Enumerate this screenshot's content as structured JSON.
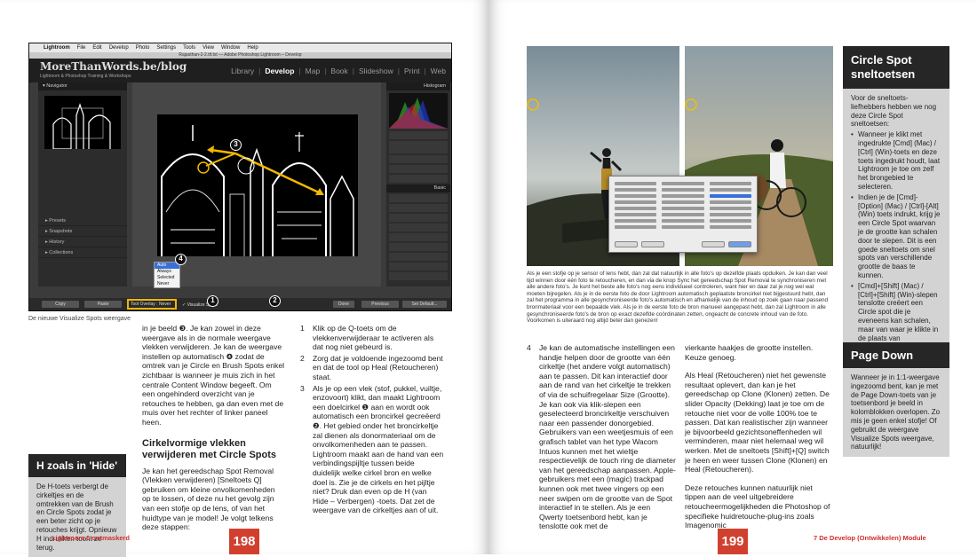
{
  "left_page": {
    "screenshot": {
      "menu_bar": [
        "Lightroom",
        "File",
        "Edit",
        "Develop",
        "Photo",
        "Settings",
        "Tools",
        "View",
        "Window",
        "Help"
      ],
      "window_title": "Rajasthan-2-2.tif.txt — Adobe Photoshop Lightroom – Develop",
      "brand": "MoreThanWords.be/blog",
      "brand_sub": "Lightroom & Photoshop Training & Workshops",
      "modules": [
        "Library",
        "Develop",
        "Map",
        "Book",
        "Slideshow",
        "Print",
        "Web"
      ],
      "active_module": "Develop",
      "left_panels": {
        "navigator": "Navigator",
        "items": [
          "Presets",
          "Snapshots",
          "History",
          "Collections"
        ]
      },
      "right_panels": {
        "histogram": "Histogram",
        "basic": "Basic"
      },
      "bottom_buttons": {
        "copy": "Copy",
        "paste": "Paste",
        "done": "Done",
        "previous": "Previous",
        "set_default": "Set Default..."
      },
      "tool_overlay": "Tool Overlay : Never",
      "visualize_spots": "✓ Visualize Spots",
      "popup_options": [
        "Auto",
        "Always",
        "Selected",
        "Never"
      ],
      "popup_selected": "Auto",
      "badges": [
        "1",
        "2",
        "3",
        "4"
      ]
    },
    "caption": "De nieuwe Visualize Spots weergave",
    "col1_intro": "in je beeld ❸. Je kan zowel in deze weergave als in de normale weergave vlekken verwijderen. Je kan de weergave instellen op automatisch ❹ zodat de omtrek van je Circle en Brush Spots enkel zichtbaar is wanneer je muis zich in het centrale Content Window begeeft. Om een ongehinderd overzicht van je retouches te hebben, ga dan even met de muis over het rechter of linker paneel heen.",
    "col1_heading": "Cirkelvormige vlekken verwijderen met Circle Spots",
    "col1_body": "Je kan het gereedschap Spot Removal (Vlekken verwijderen) [Sneltoets Q] gebruiken om kleine onvolkomenheden op te lossen, of deze nu het gevolg zijn van een stofje op de lens, of van het huidtype van je model! Je volgt telkens deze stappen:",
    "steps": [
      {
        "num": "1",
        "text": "Klik op de Q-toets om de vlekkenverwijderaar te activeren als dat nog niet gebeurd is."
      },
      {
        "num": "2",
        "text": "Zorg dat je voldoende ingezoomd bent en dat de tool op Heal (Retoucheren) staat."
      },
      {
        "num": "3",
        "text": "Als je op een vlek (stof, pukkel, vuiltje, enzovoort) klikt, dan maakt Lightroom een doelcirkel ❶ aan en wordt ook automatisch een broncirkel gecreëerd ❷. Het gebied onder het broncirkeltje zal dienen als donormateriaal om de onvolkomenheden aan te passen. Lightroom maakt aan de hand van een verbindingspijltje tussen beide duidelijk welke cirkel bron en welke doel is. Zie je de cirkels en het pijltje niet? Druk dan even op de H (van Hide – Verbergen) -toets. Dat zet de weergave van de cirkeltjes aan of uit."
      }
    ],
    "sidebar": {
      "title": "H zoals in 'Hide'",
      "body": "De H-toets verbergt de cirkeltjes en de omtrekken van de Brush en Circle Spots zodat je een beter zicht op je retouches krijgt. Opnieuw H indrukken toont ze terug."
    },
    "footer": {
      "title": "Lightroom 5 ontmaskerd",
      "page": "198"
    }
  },
  "right_page": {
    "caption": "Als je een stofje op je sensor of lens hebt, dan zal dat natuurlijk in alle foto's op dezelfde plaats opduiken. Je kan dan veel tijd winnen door één foto te retoucheren, en dan via de knop Sync het gereedschap Spot Removal te synchroniseren met alle andere foto's. Je kunt het beste alle foto's nog eens individueel controleren, want hier en daar zal je nog wel wat moeten bijregelen. Als je in de eerste foto de door Lightroom automatisch geplaatste broncirkel niet bijgestuurd hebt, dan zal het programma in alle gesynchroniseerde foto's automatisch en afhankelijk van de inhoud op zoek gaan naar passend bronmateriaal voor een bepaalde vlek. Als je in de eerste foto de bron manueel aangepast hebt, dan zal Lightroom in alle gesynchroniseerde foto's de bron op exact dezelfde coördinaten zetten, ongeacht de concrete inhoud van de foto. Voorkomen is uiteraard nog altijd beter dan genezen!",
    "step4": {
      "num": "4",
      "text": "Je kan de automatische instellingen een handje helpen door de grootte van één cirkeltje (het andere volgt automatisch) aan te passen. Dit kan interactief door aan de rand van het cirkeltje te trekken of via de schuifregelaar Size (Grootte). Je kan ook via klik-slepen een geselecteerd broncirkeltje verschuiven naar een passender donorgebied. Gebruikers van een weetjesmuis of een grafisch tablet van het type Wacom Intuos kunnen met het wieltje respectievelijk de touch ring de diameter van het gereedschap aanpassen. Apple-gebruikers met een (magic) trackpad kunnen ook met twee vingers op een neer swipen om de grootte van de Spot interactief in te stellen. Als je een Qwerty toetsenbord hebt, kan je tenslotte ook met de"
    },
    "col2_p1": "vierkante haakjes de grootte instellen. Keuze genoeg.",
    "col2_p2": "Als Heal (Retoucheren) niet het gewenste resultaat oplevert, dan kan je het gereedschap op Clone (Klonen) zetten. De slider Opacity (Dekking) laat je toe om de retouche niet voor de volle 100% toe te passen. Dat kan realistischer zijn wanneer je bijvoorbeeld gezichtsoneffenheden wil verminderen, maar niet helemaal weg wil werken. Met de sneltoets [Shift]+[Q] switch je heen en weer tussen Clone (Klonen) en Heal (Retoucheren).",
    "col2_p3": "Deze retouches kunnen natuurlijk niet tippen aan de veel uitgebreidere retoucheermogelijkheden die Photoshop of specifieke huidretouche-plug-ins zoals Imagenomic",
    "sidebar1": {
      "title": "Circle Spot sneltoetsen",
      "intro": "Voor de sneltoets-liefhebbers hebben we nog deze Circle Spot sneltoetsen:",
      "bullets": [
        "Wanneer je klikt met ingedrukte [Cmd] (Mac) / [Ctrl] (Win)-toets en deze toets ingedrukt houdt, laat Lightroom je toe om zelf het brongebied te selecteren.",
        "Indien je de [Cmd]-[Option] (Mac) / [Ctrl]-[Alt] (Win) toets indrukt, krijg je een Circle Spot waarvan je de grootte kan schalen door te slepen. Dit is een goede sneltoets om snel spots van verschillende grootte de baas te kunnen.",
        "[Cmd]+[Shift] (Mac) / [Ctrl]+[Shift] (Win)-slepen tenslotte creëert een Circle spot die je eveneens kan schalen, maar van waar je klikte in de plaats van gecentreerd."
      ]
    },
    "sidebar2": {
      "title": "Page Down",
      "body": "Wanneer je in 1:1-weergave ingezoomd bent, kan je met de Page Down-toets van je toetsenbord je beeld in kolomblokken overlopen. Zo mis je geen enkel stofje! Of gebruikt de weergave Visualize Spots weergave, natuurlijk!"
    },
    "footer": {
      "title": "7  De Develop (Ontwikkelen) Module",
      "page": "199"
    }
  },
  "colors": {
    "accent_red": "#d1402f",
    "sidebar_dark": "#262626",
    "sidebar_light": "#d3d3d3",
    "callout_yellow": "#f0b800"
  }
}
